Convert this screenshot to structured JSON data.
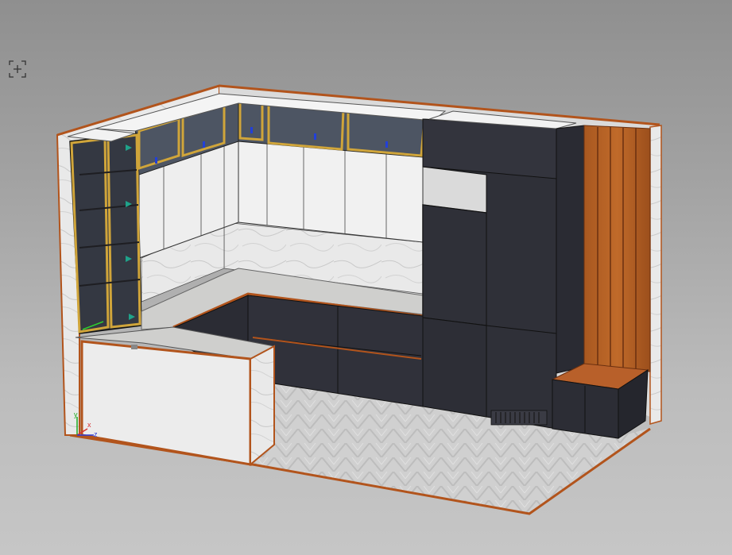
{
  "viewport": {
    "title": "",
    "background_top": "#8f8f8f",
    "background_bottom": "#c6c6c6"
  },
  "toolbar": {
    "zoom_extents_icon": "zoom-extents-icon"
  },
  "scene": {
    "description_icon": "kitchen-3d-model",
    "materials": {
      "cabinet_dark": "#2f3038",
      "cabinet_white": "#f0f0f0",
      "countertop": "#d4d4d2",
      "marble": "#e6e6e6",
      "wood_trim": "#b2541c",
      "gold_frame": "#d0a53a",
      "glass": "#4d5563"
    },
    "axis_labels": {
      "x": "x",
      "y": "y",
      "z": "z"
    }
  }
}
